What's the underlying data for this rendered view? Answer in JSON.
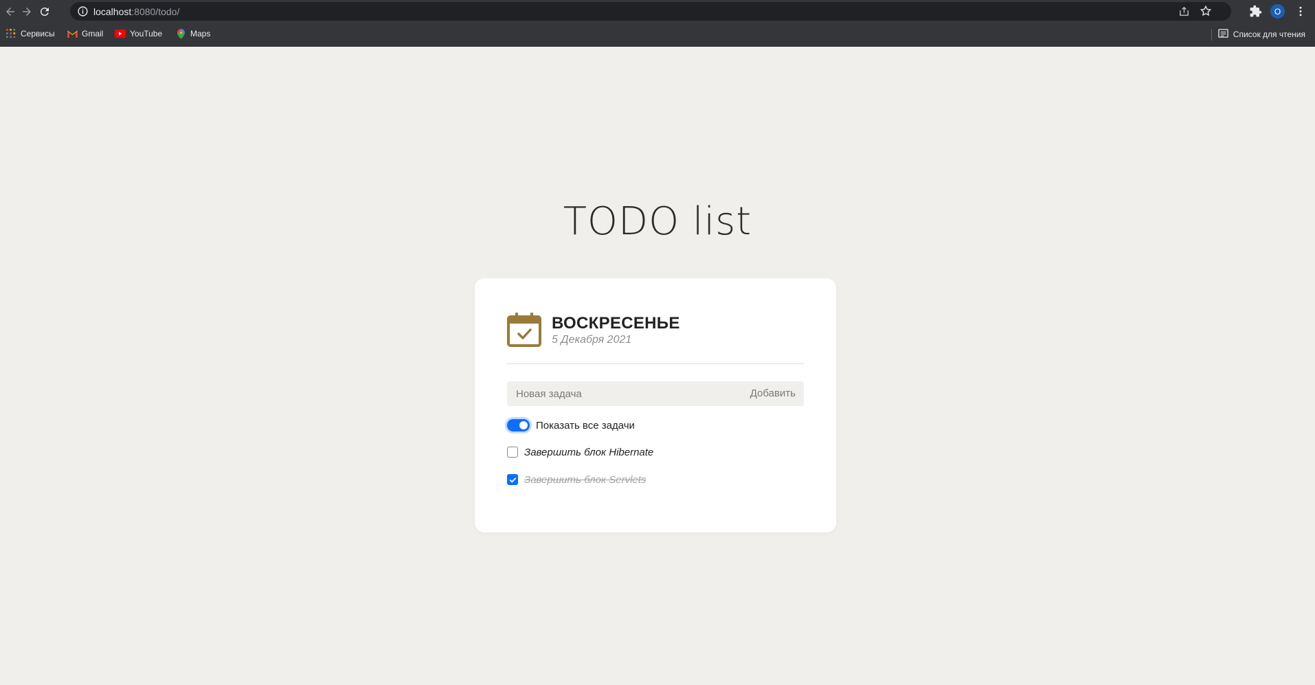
{
  "browser": {
    "url_host": "localhost",
    "url_rest": ":8080/todo/",
    "profile_initial": "O",
    "bookmarks": [
      {
        "label": "Сервисы",
        "icon": "apps-grid-icon"
      },
      {
        "label": "Gmail",
        "icon": "gmail-icon"
      },
      {
        "label": "YouTube",
        "icon": "youtube-icon"
      },
      {
        "label": "Maps",
        "icon": "maps-icon"
      }
    ],
    "reading_list_label": "Список для чтения"
  },
  "page": {
    "title": "TODO list"
  },
  "card": {
    "day_name": "ВОСКРЕСЕНЬЕ",
    "date": "5 Декабря 2021",
    "new_task_placeholder": "Новая задача",
    "add_button_label": "Добавить",
    "show_all_label": "Показать все задачи",
    "show_all_enabled": true,
    "tasks": [
      {
        "text": "Завершить блок Hibernate",
        "done": false
      },
      {
        "text": "Завершить блок Servlets",
        "done": true
      }
    ]
  },
  "colors": {
    "page_background": "#f0efeb",
    "card_background": "#ffffff",
    "accent": "#0d6efd",
    "calendar_icon": "#9a7a3b",
    "chrome": "#35363a"
  }
}
